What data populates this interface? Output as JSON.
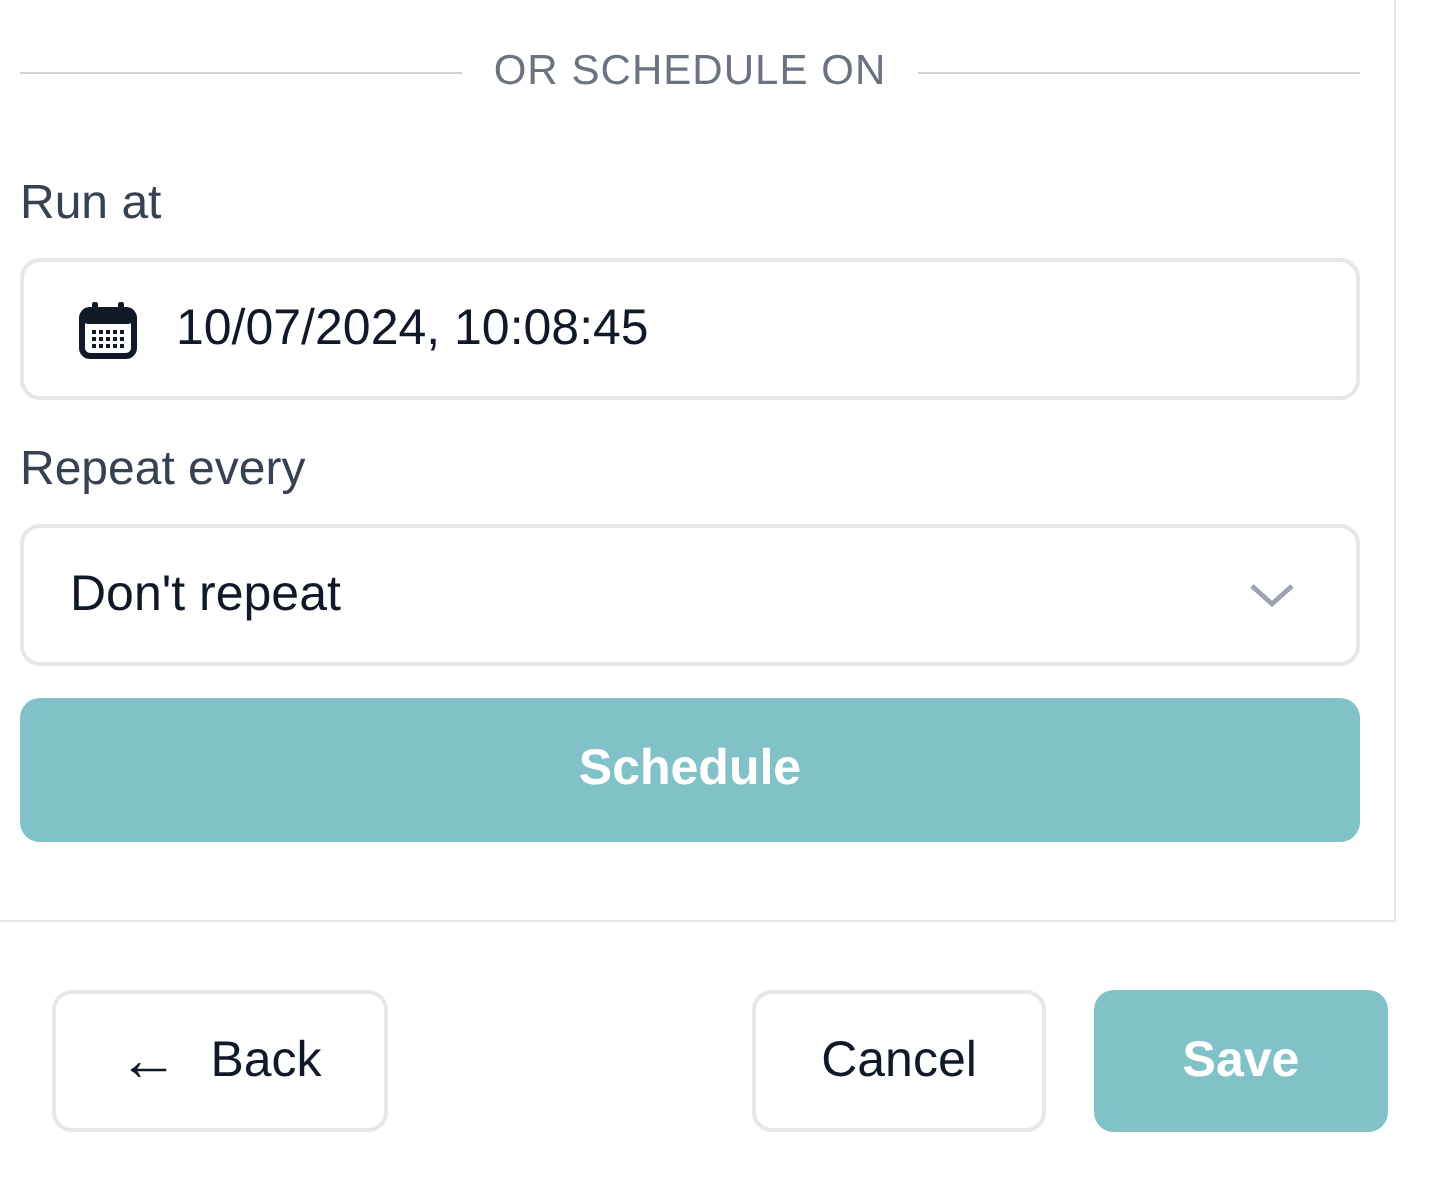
{
  "divider_label": "OR SCHEDULE ON",
  "run_at": {
    "label": "Run at",
    "value": "10/07/2024, 10:08:45"
  },
  "repeat_every": {
    "label": "Repeat every",
    "value": "Don't repeat"
  },
  "schedule_button": {
    "label": "Schedule",
    "disabled": true
  },
  "footer": {
    "back": {
      "label": "Back",
      "icon": "←"
    },
    "cancel": {
      "label": "Cancel"
    },
    "save": {
      "label": "Save",
      "disabled": true
    }
  }
}
